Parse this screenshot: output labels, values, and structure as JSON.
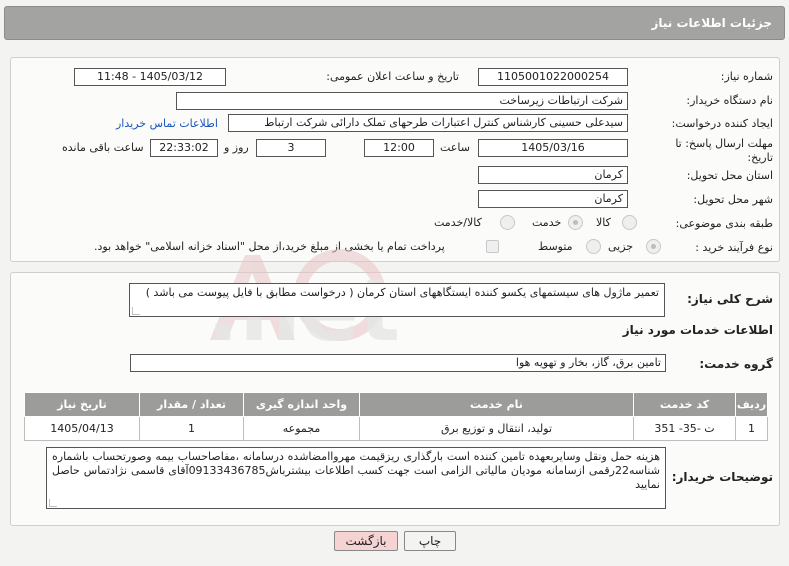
{
  "header": {
    "title": "جزئیات اطلاعات نیاز"
  },
  "form": {
    "need_number_label": "شماره نیاز:",
    "need_number": "1105001022000254",
    "announce_label": "تاریخ و ساعت اعلان عمومی:",
    "announce_value": "1405/03/12 - 11:48",
    "buyer_org_label": "نام دستگاه خریدار:",
    "buyer_org": "شرکت ارتباطات زیرساخت",
    "creator_label": "ایجاد کننده درخواست:",
    "creator": "سیدعلی حسینی کارشناس کنترل اعتبارات طرحهای تملک دارائی شرکت ارتباط",
    "contact_link": "اطلاعات تماس خریدار",
    "deadline_label": "مهلت ارسال پاسخ: تا تاریخ:",
    "deadline_date": "1405/03/16",
    "time_label": "ساعت",
    "deadline_time": "12:00",
    "days_value": "3",
    "days_label": "روز و",
    "remaining_time": "22:33:02",
    "remaining_label": "ساعت باقی مانده",
    "province_label": "استان محل تحویل:",
    "province": "کرمان",
    "city_label": "شهر محل تحویل:",
    "city": "کرمان",
    "category_label": "طبقه بندی موضوعی:",
    "category_options": [
      "کالا",
      "خدمت",
      "کالا/خدمت"
    ],
    "category_selected": "خدمت",
    "process_label": "نوع فرآیند خرید :",
    "process_options": [
      "جزیی",
      "متوسط"
    ],
    "process_selected": "جزیی",
    "payment_note": "پرداخت تمام یا بخشی از مبلغ خرید،از محل \"اسناد خزانه اسلامی\" خواهد بود."
  },
  "description": {
    "label": "شرح کلی نیاز:",
    "text": "تعمیر ماژول های سیستمهای یکسو کننده ایستگاههای استان کرمان ( درخواست مطابق با فایل پیوست می باشد )"
  },
  "services": {
    "section_title": "اطلاعات خدمات مورد نیاز",
    "group_label": "گروه خدمت:",
    "group_value": "تامین برق، گاز، بخار و تهویه هوا",
    "columns": [
      "ردیف",
      "کد خدمت",
      "نام خدمت",
      "واحد اندازه گیری",
      "تعداد / مقدار",
      "تاریخ نیاز"
    ],
    "rows": [
      [
        "1",
        "ت -35- 351",
        "تولید، انتقال و توزیع برق",
        "مجموعه",
        "1",
        "1405/04/13"
      ]
    ]
  },
  "buyer_notes": {
    "label": "توضیحات خریدار:",
    "text": "هزینه حمل ونقل وسایربعهده تامین کننده است بارگذاری ریزقیمت مهرواامضاشده درسامانه ،مفاصاحساب بیمه وصورتحساب باشماره شناسه22رقمی ازسامانه مودیان مالیاتی الزامی است جهت کسب اطلاعات بیشترباش09133436785آقای قاسمی نژادتماس حاصل نمایید"
  },
  "buttons": {
    "print": "چاپ",
    "back": "بازگشت"
  },
  "colors": {
    "header_bg": "#a3a3a1",
    "link": "#1a56b8",
    "back_btn": "#f6d3d3"
  }
}
